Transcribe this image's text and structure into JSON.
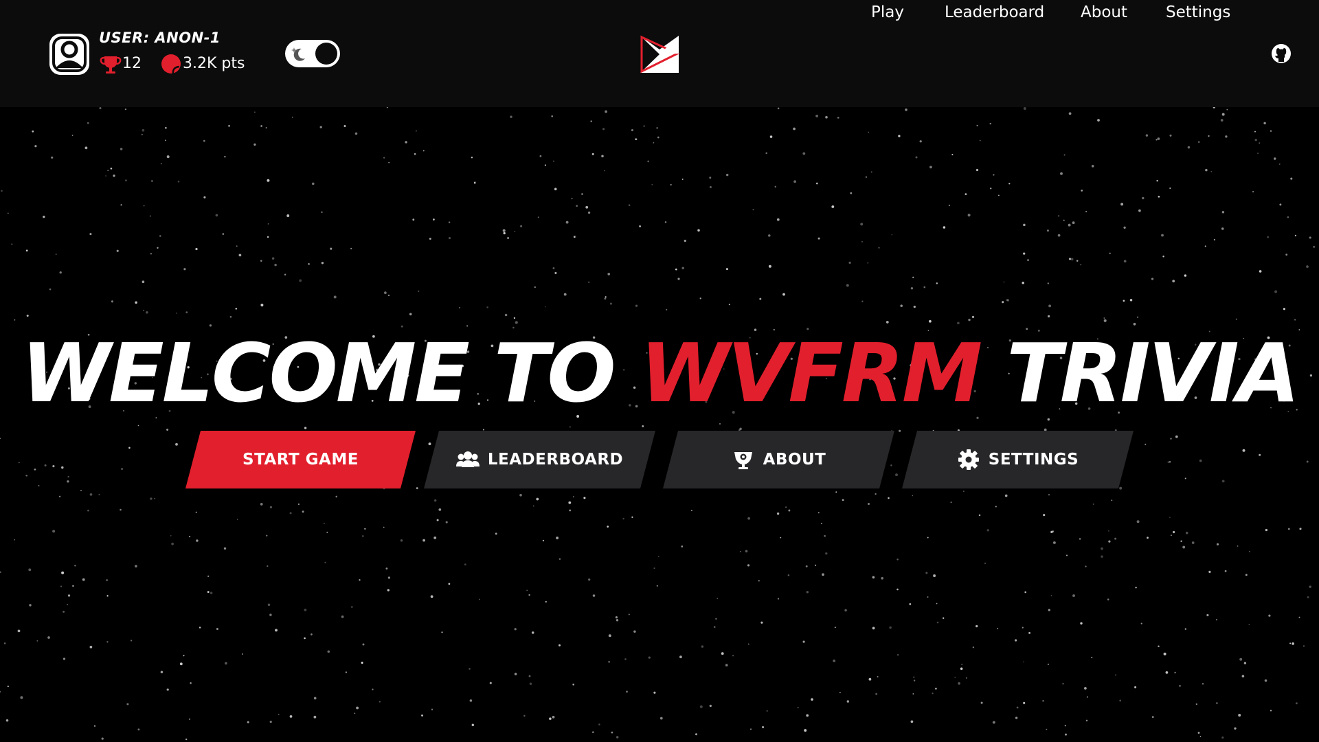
{
  "user": {
    "label": "USER: ANON-1",
    "trophies": "12",
    "points": "3.2K pts"
  },
  "theme_toggle": {
    "mode": "dark"
  },
  "nav": {
    "links": [
      "Play",
      "Leaderboard",
      "About",
      "Settings"
    ]
  },
  "hero": {
    "title_prefix": "WELCOME TO ",
    "title_accent": "WVFRM",
    "title_suffix": " TRIVIA"
  },
  "buttons": {
    "start": "START GAME",
    "leaderboard": "LEADERBOARD",
    "about": "ABOUT",
    "settings": "SETTINGS"
  },
  "icons": {
    "avatar": "user-avatar-icon",
    "trophy": "trophy-icon",
    "points": "points-icon",
    "moon": "moon-icon",
    "logo": "wvfrm-logo",
    "github": "github-icon",
    "leaderboard": "users-icon",
    "about": "badge-icon",
    "settings": "gear-icon"
  },
  "colors": {
    "accent": "#e21f2d",
    "header_bg": "#0c0c0c",
    "button_dark": "#27272a",
    "background": "#000000"
  }
}
